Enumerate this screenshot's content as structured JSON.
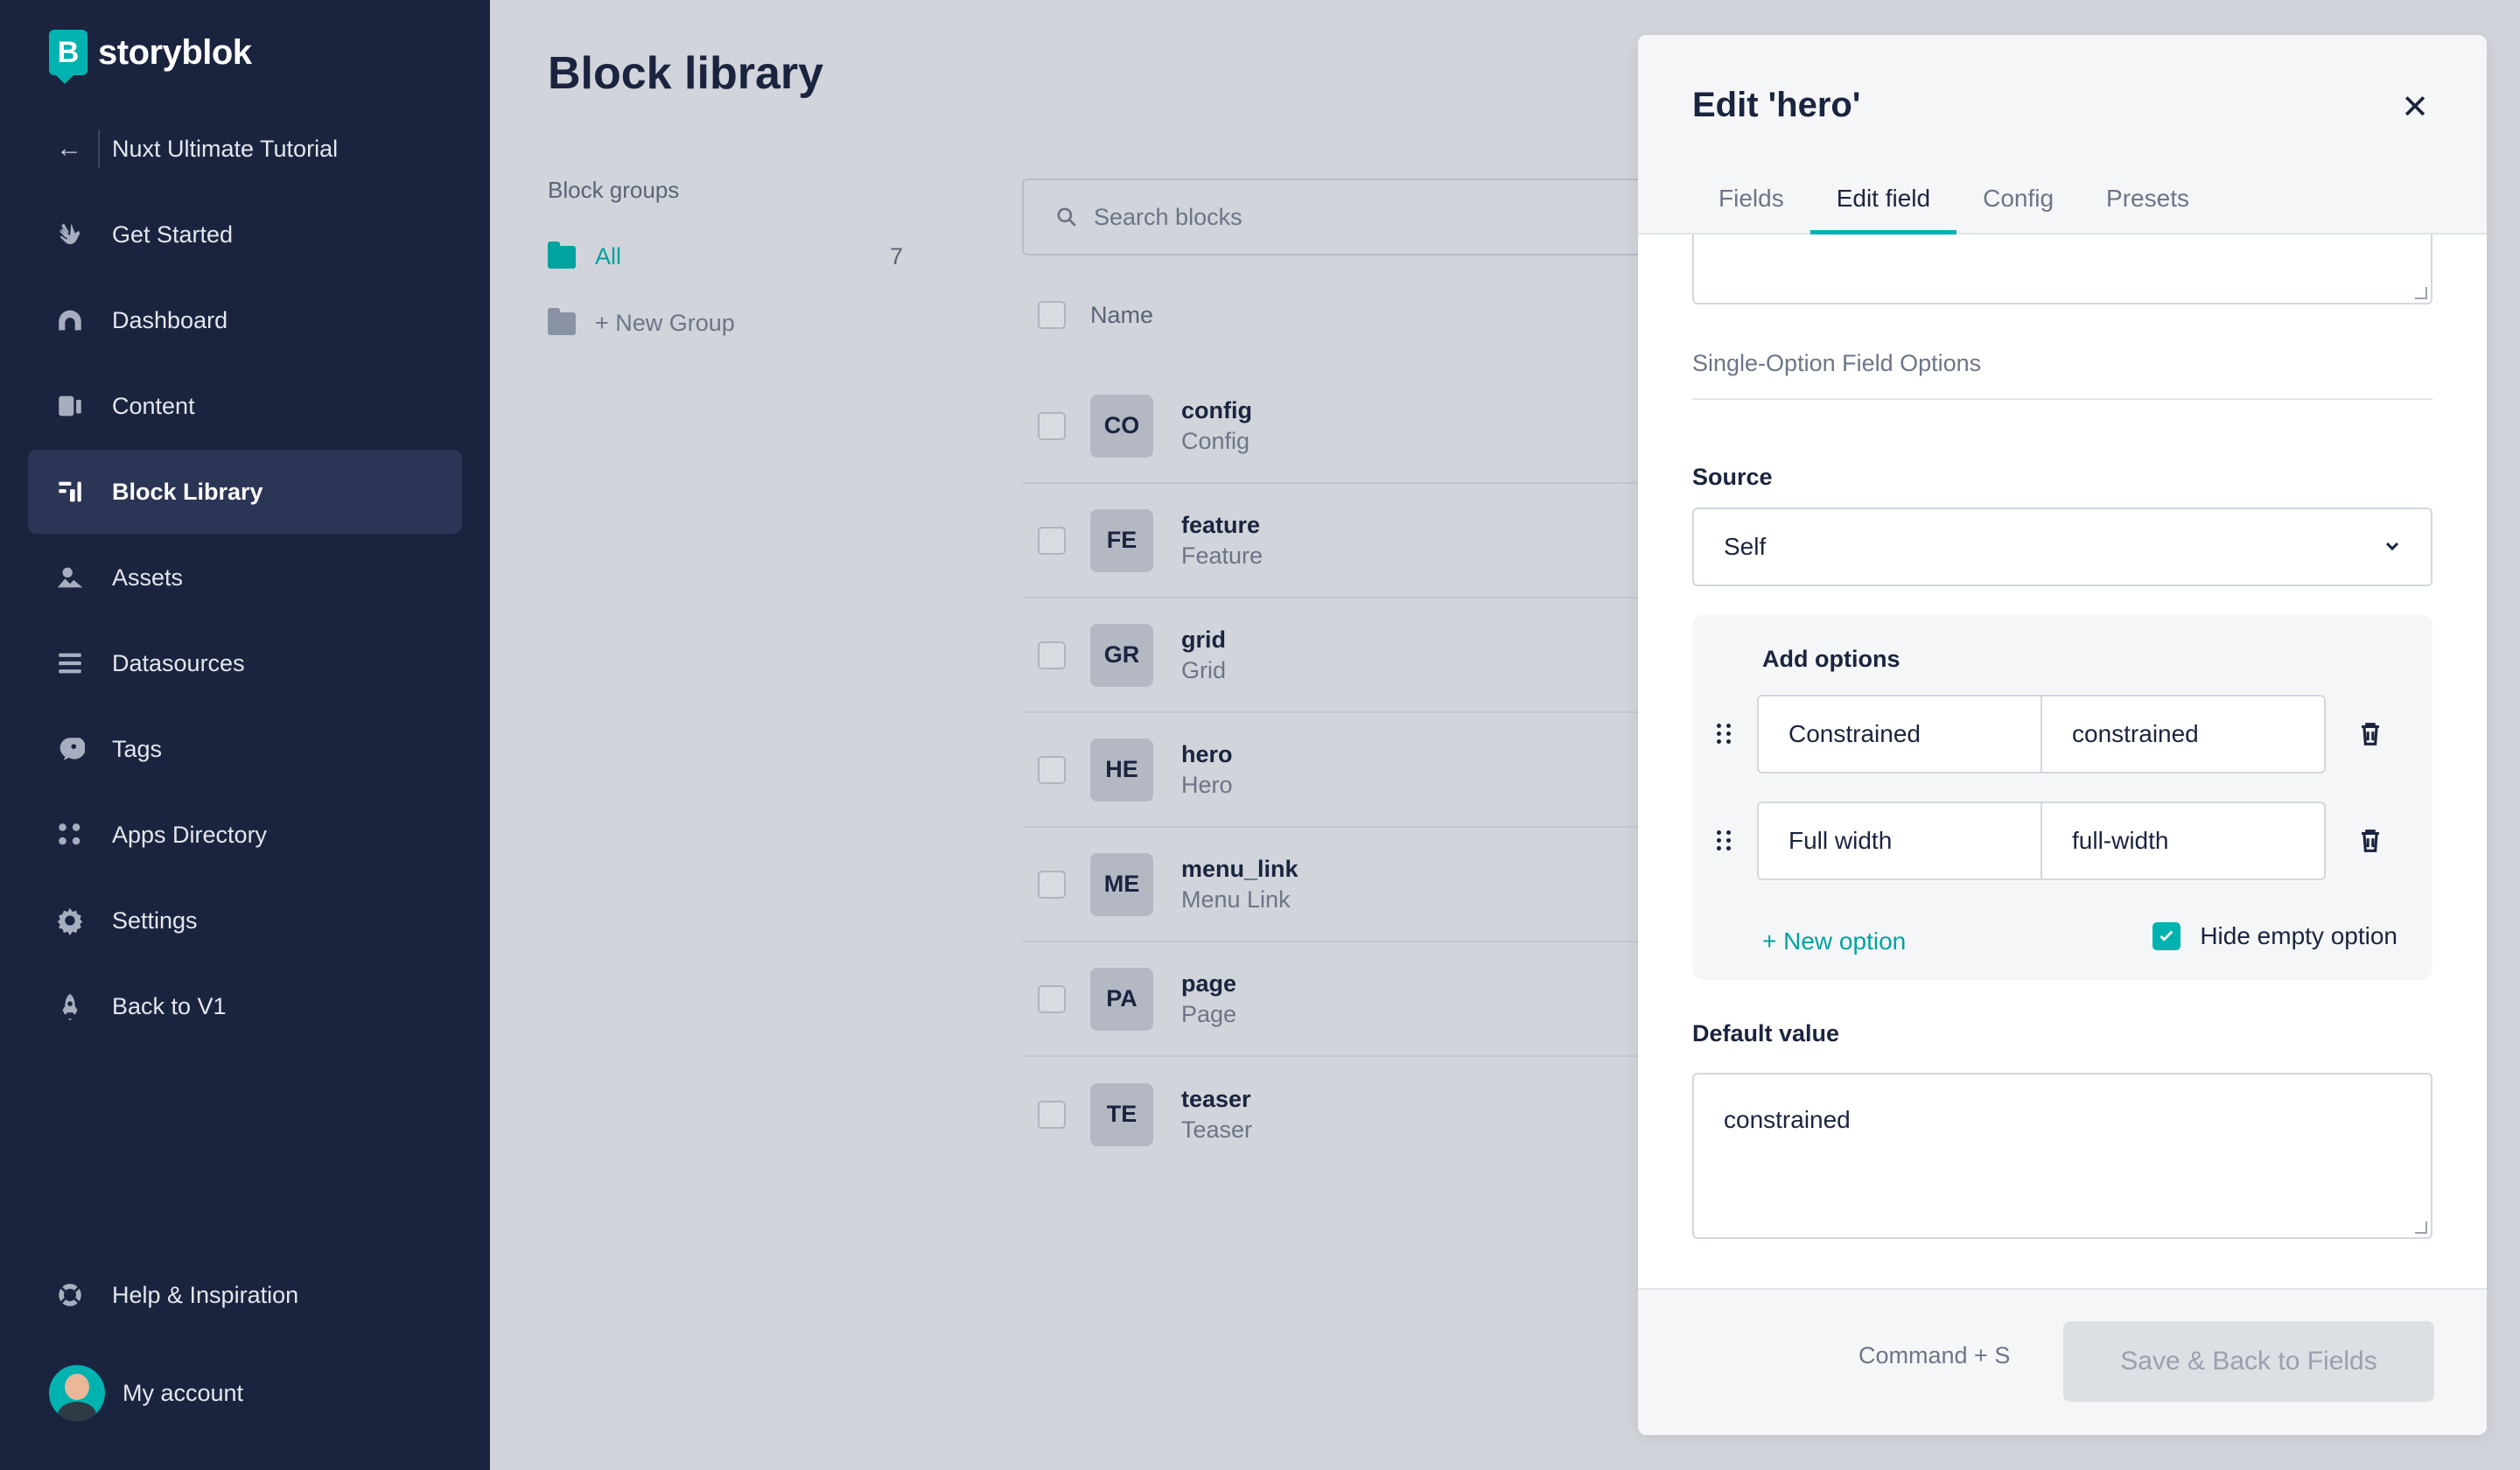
{
  "app": {
    "logo_text": "storyblok",
    "logo_letter": "B"
  },
  "space": {
    "name": "Nuxt Ultimate Tutorial"
  },
  "sidebar": {
    "items": [
      {
        "label": "Get Started",
        "icon": "waving-hand-icon"
      },
      {
        "label": "Dashboard",
        "icon": "dashboard-icon"
      },
      {
        "label": "Content",
        "icon": "content-icon"
      },
      {
        "label": "Block Library",
        "icon": "block-library-icon",
        "active": true
      },
      {
        "label": "Assets",
        "icon": "assets-icon"
      },
      {
        "label": "Datasources",
        "icon": "datasources-icon"
      },
      {
        "label": "Tags",
        "icon": "tag-icon"
      },
      {
        "label": "Apps Directory",
        "icon": "apps-icon"
      },
      {
        "label": "Settings",
        "icon": "gear-icon"
      },
      {
        "label": "Back to V1",
        "icon": "rocket-icon"
      }
    ],
    "help_label": "Help & Inspiration",
    "account_label": "My account"
  },
  "main": {
    "title": "Block library",
    "groups_title": "Block groups",
    "group_all": {
      "label": "All",
      "count": "7"
    },
    "new_group_label": "+ New Group",
    "search_placeholder": "Search blocks",
    "name_header": "Name",
    "blocks": [
      {
        "badge": "CO",
        "name": "config",
        "display": "Config"
      },
      {
        "badge": "FE",
        "name": "feature",
        "display": "Feature"
      },
      {
        "badge": "GR",
        "name": "grid",
        "display": "Grid"
      },
      {
        "badge": "HE",
        "name": "hero",
        "display": "Hero"
      },
      {
        "badge": "ME",
        "name": "menu_link",
        "display": "Menu Link"
      },
      {
        "badge": "PA",
        "name": "page",
        "display": "Page"
      },
      {
        "badge": "TE",
        "name": "teaser",
        "display": "Teaser"
      }
    ]
  },
  "modal": {
    "title": "Edit 'hero'",
    "tabs": [
      {
        "label": "Fields"
      },
      {
        "label": "Edit field",
        "active": true
      },
      {
        "label": "Config"
      },
      {
        "label": "Presets"
      }
    ],
    "section_title": "Single-Option Field Options",
    "source_label": "Source",
    "source_value": "Self",
    "options_title": "Add options",
    "options": [
      {
        "name": "Constrained",
        "value": "constrained"
      },
      {
        "name": "Full width",
        "value": "full-width"
      }
    ],
    "new_option_label": "+ New option",
    "hide_empty_label": "Hide empty option",
    "default_label": "Default value",
    "default_value": "constrained",
    "shortcut_hint": "Command + S",
    "save_label": "Save & Back to Fields"
  },
  "colors": {
    "accent": "#00b3b0",
    "sidebar_bg": "#1b243f",
    "overlay_bg": "#d1d4da"
  }
}
